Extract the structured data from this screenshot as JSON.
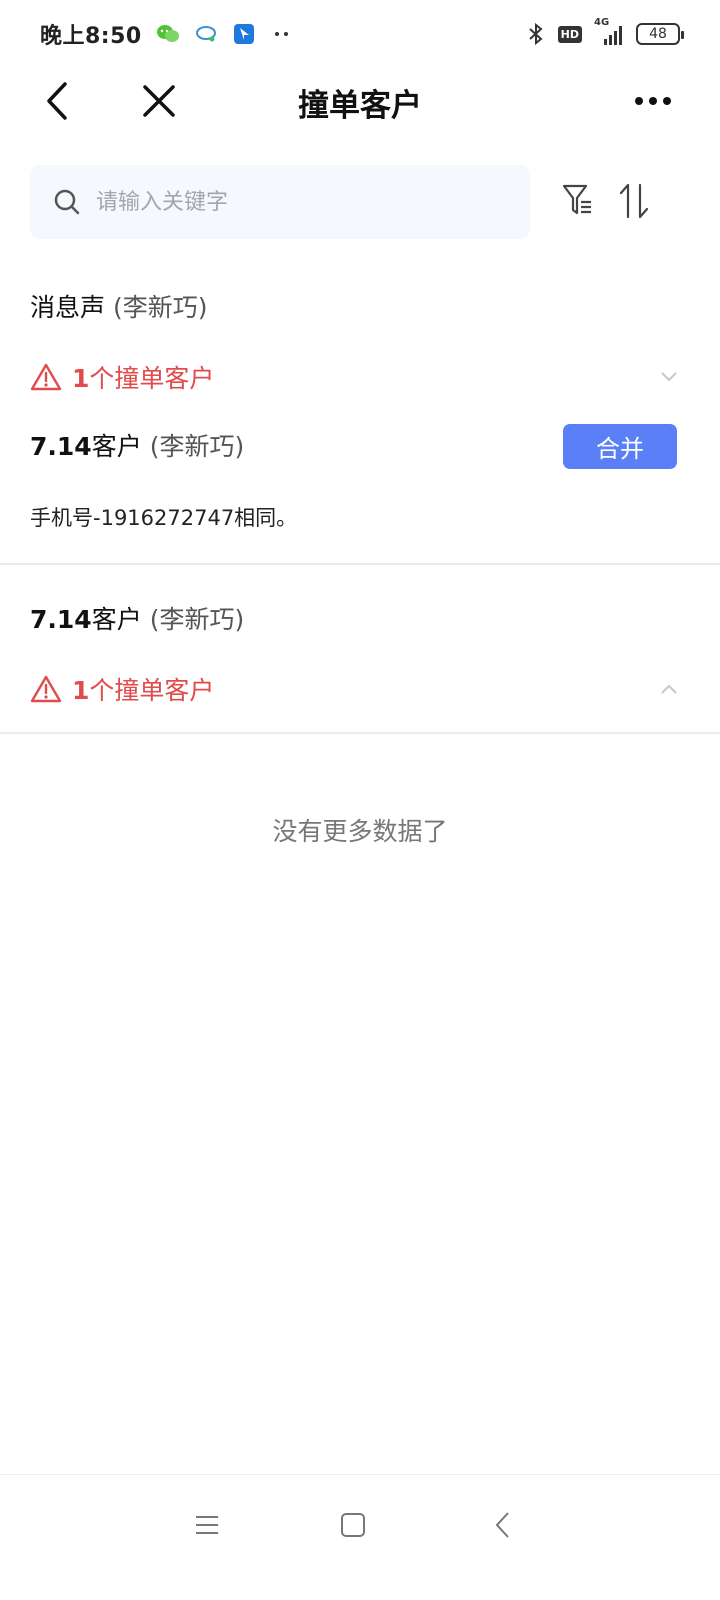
{
  "status_bar": {
    "time": "晚上8:50",
    "hd": "HD",
    "network": "4G",
    "battery": "48"
  },
  "nav": {
    "title": "撞单客户"
  },
  "search": {
    "placeholder": "请输入关键字"
  },
  "groups": [
    {
      "customer_name": "消息声",
      "owner": "(李新巧)",
      "dup_count": "1",
      "dup_label": "个撞单客户",
      "expanded": true,
      "matches": [
        {
          "name_num": "7.14",
          "name_suffix": "客户",
          "owner": "(李新巧)",
          "action": "合并",
          "reason": "手机号-1916272747相同。"
        }
      ]
    },
    {
      "name_num": "7.14",
      "name_suffix": "客户",
      "owner": "(李新巧)",
      "dup_count": "1",
      "dup_label": "个撞单客户",
      "expanded": false
    }
  ],
  "footer": {
    "no_more": "没有更多数据了"
  },
  "colors": {
    "accent": "#5b7ff6",
    "warning": "#e24b4b",
    "search_bg": "#f5f8fd"
  }
}
